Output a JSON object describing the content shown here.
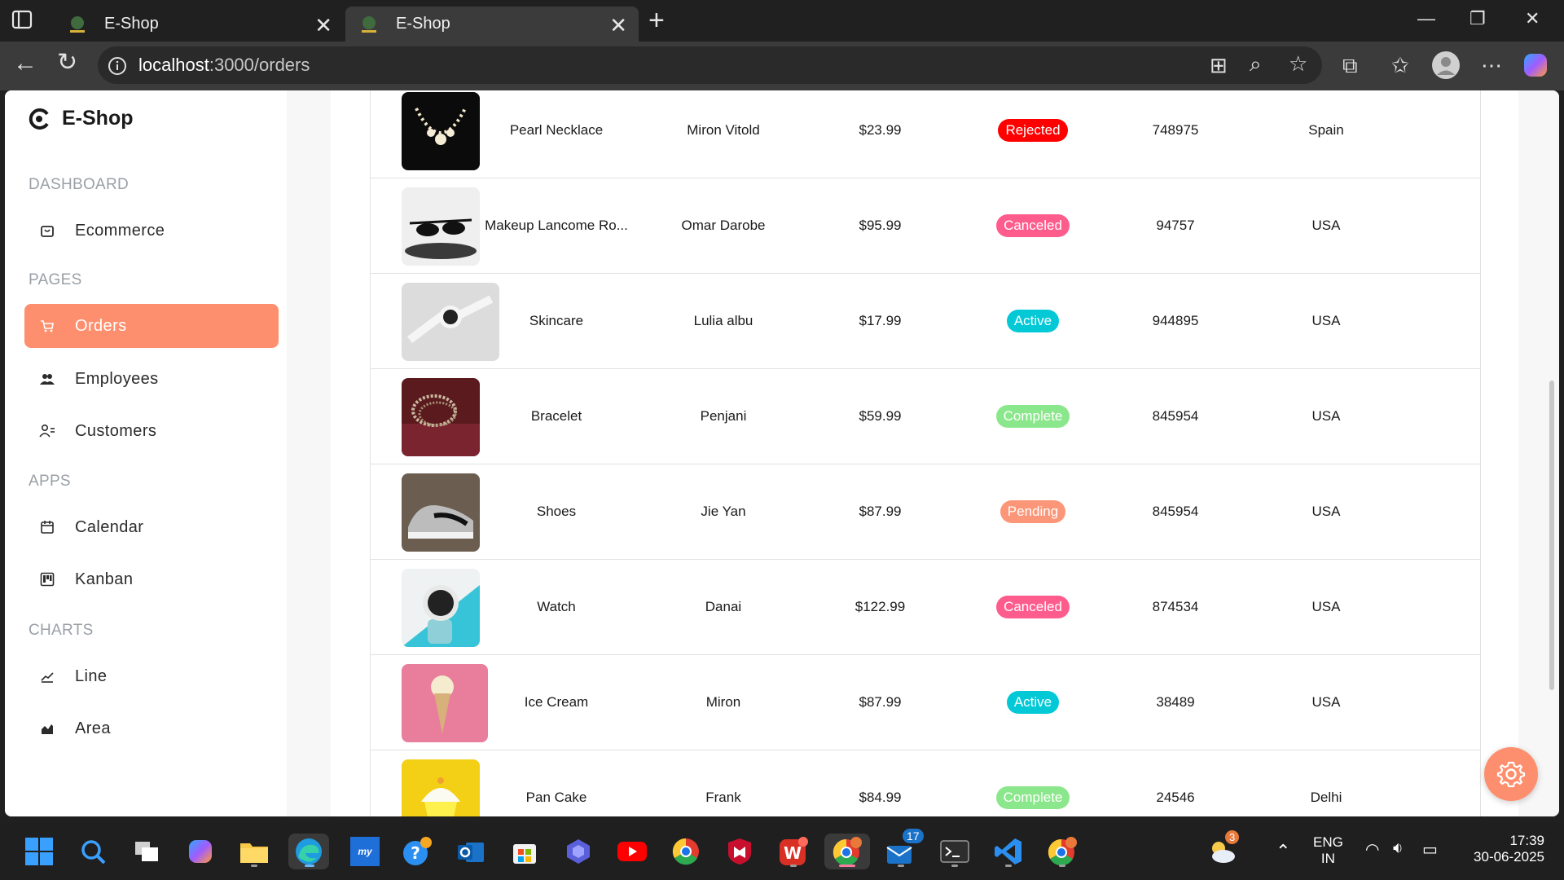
{
  "browser": {
    "tabs": [
      {
        "title": "E-Shop",
        "active": false
      },
      {
        "title": "E-Shop",
        "active": true
      }
    ],
    "url_host": "localhost",
    "url_path": ":3000/orders"
  },
  "sidebar": {
    "brand": "E-Shop",
    "sections": {
      "dashboard": "DASHBOARD",
      "pages": "PAGES",
      "apps": "APPS",
      "charts": "CHARTS"
    },
    "items": {
      "ecommerce": "Ecommerce",
      "orders": "Orders",
      "employees": "Employees",
      "customers": "Customers",
      "calendar": "Calendar",
      "kanban": "Kanban",
      "line": "Line",
      "area": "Area"
    },
    "active_item": "orders"
  },
  "orders": [
    {
      "item": "Pearl Necklace",
      "customer": "Miron Vitold",
      "amount": "$23.99",
      "status": "Rejected",
      "status_color": "#ff0000",
      "order_id": "748975",
      "location": "Spain",
      "image": "necklace"
    },
    {
      "item": "Makeup Lancome Ro...",
      "customer": "Omar Darobe",
      "amount": "$95.99",
      "status": "Canceled",
      "status_color": "#ff5c8e",
      "order_id": "94757",
      "location": "USA",
      "image": "sunglasses"
    },
    {
      "item": "Skincare",
      "customer": "Lulia albu",
      "amount": "$17.99",
      "status": "Active",
      "status_color": "#03c9d7",
      "order_id": "944895",
      "location": "USA",
      "image": "smartwatch"
    },
    {
      "item": "Bracelet",
      "customer": "Penjani",
      "amount": "$59.99",
      "status": "Complete",
      "status_color": "#8be78b",
      "order_id": "845954",
      "location": "USA",
      "image": "bracelet"
    },
    {
      "item": "Shoes",
      "customer": "Jie Yan",
      "amount": "$87.99",
      "status": "Pending",
      "status_color": "#fb9678",
      "order_id": "845954",
      "location": "USA",
      "image": "shoes"
    },
    {
      "item": "Watch",
      "customer": "Danai",
      "amount": "$122.99",
      "status": "Canceled",
      "status_color": "#ff5c8e",
      "order_id": "874534",
      "location": "USA",
      "image": "watch"
    },
    {
      "item": "Ice Cream",
      "customer": "Miron",
      "amount": "$87.99",
      "status": "Active",
      "status_color": "#03c9d7",
      "order_id": "38489",
      "location": "USA",
      "image": "icecream"
    },
    {
      "item": "Pan Cake",
      "customer": "Frank",
      "amount": "$84.99",
      "status": "Complete",
      "status_color": "#8be78b",
      "order_id": "24546",
      "location": "Delhi",
      "image": "cupcake"
    }
  ],
  "theme": {
    "accent": "#fe8f6e"
  },
  "taskbar": {
    "outlook_badge": "17",
    "weather_badge": "3",
    "lang_primary": "ENG",
    "lang_secondary": "IN",
    "time": "17:39",
    "date": "30-06-2025"
  }
}
